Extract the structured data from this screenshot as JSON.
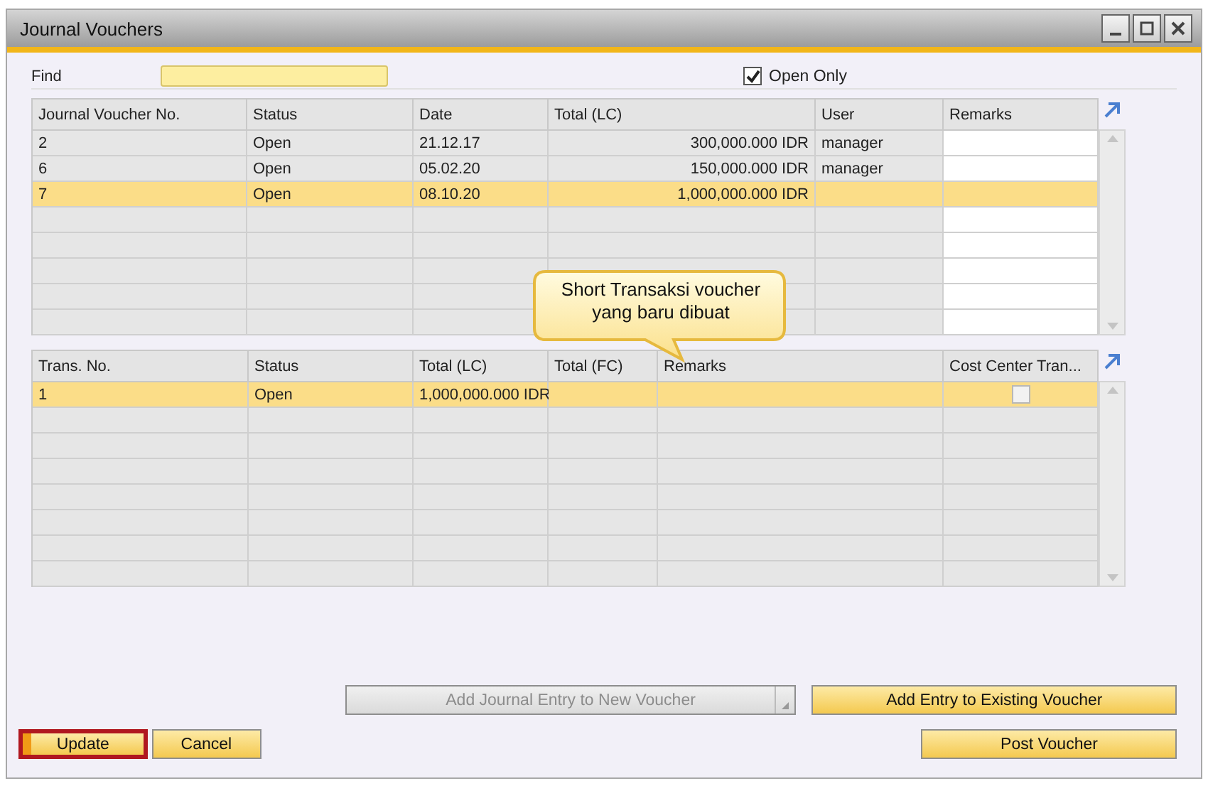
{
  "window": {
    "title": "Journal Vouchers"
  },
  "find": {
    "label": "Find"
  },
  "open_only": {
    "label": "Open Only",
    "checked": true
  },
  "vouchers": {
    "columns": [
      "Journal Voucher No.",
      "Status",
      "Date",
      "Total (LC)",
      "User",
      "Remarks"
    ],
    "rows": [
      {
        "cells": [
          "2",
          "Open",
          "21.12.17",
          "300,000.000 IDR",
          "manager",
          ""
        ],
        "selected": false
      },
      {
        "cells": [
          "6",
          "Open",
          "05.02.20",
          "150,000.000 IDR",
          "manager",
          ""
        ],
        "selected": false
      },
      {
        "cells": [
          "7",
          "Open",
          "08.10.20",
          "1,000,000.000 IDR",
          "",
          ""
        ],
        "selected": true
      }
    ]
  },
  "transactions": {
    "columns": [
      "Trans. No.",
      "Status",
      "Total (LC)",
      "Total (FC)",
      "Remarks",
      "Cost Center Tran..."
    ],
    "rows": [
      {
        "cells": [
          "1",
          "Open",
          "1,000,000.000 IDR",
          "",
          ""
        ],
        "selected": true,
        "cost_center_checked": false
      }
    ]
  },
  "callout": {
    "text": "Short Transaksi voucher yang baru dibuat"
  },
  "buttons": [
    {
      "label": "Add Journal Entry to New Voucher",
      "kind": "dropdown",
      "disabled": true,
      "highlighted": false
    },
    {
      "label": "Add Entry to Existing Voucher",
      "kind": "plain",
      "disabled": false,
      "highlighted": false
    },
    {
      "label": "Update",
      "kind": "primary",
      "disabled": false,
      "highlighted": true
    },
    {
      "label": "Cancel",
      "kind": "plain",
      "disabled": false,
      "highlighted": false
    },
    {
      "label": "Post Voucher",
      "kind": "plain",
      "disabled": false,
      "highlighted": false
    }
  ]
}
